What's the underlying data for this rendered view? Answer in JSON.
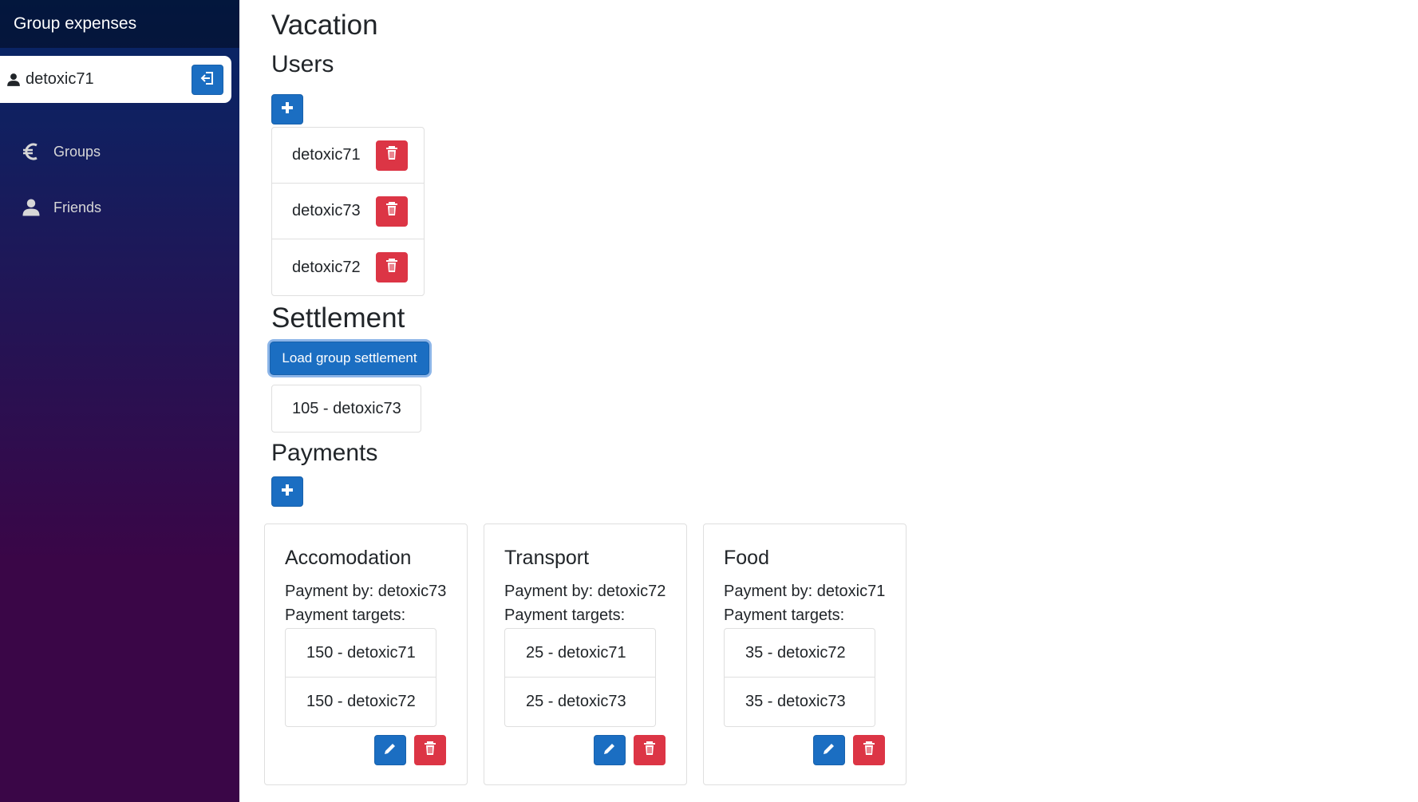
{
  "app": {
    "brand": "Group expenses"
  },
  "user": {
    "name": "detoxic71"
  },
  "nav": [
    {
      "label": "Groups",
      "icon": "euro-icon"
    },
    {
      "label": "Friends",
      "icon": "person-icon"
    }
  ],
  "group": {
    "title": "Vacation"
  },
  "users_section": {
    "heading": "Users",
    "users": [
      "detoxic71",
      "detoxic73",
      "detoxic72"
    ]
  },
  "settlement": {
    "heading": "Settlement",
    "load_button": "Load group settlement",
    "result": "105 - detoxic73"
  },
  "payments": {
    "heading": "Payments",
    "items": [
      {
        "title": "Accomodation",
        "by": "Payment by: detoxic73",
        "targets_label": "Payment targets:",
        "targets": [
          "150 - detoxic71",
          "150 - detoxic72"
        ]
      },
      {
        "title": "Transport",
        "by": "Payment by: detoxic72",
        "targets_label": "Payment targets:",
        "targets": [
          "25 - detoxic71",
          "25 - detoxic73"
        ]
      },
      {
        "title": "Food",
        "by": "Payment by: detoxic71",
        "targets_label": "Payment targets:",
        "targets": [
          "35 - detoxic72",
          "35 - detoxic73"
        ]
      }
    ]
  },
  "colors": {
    "primary": "#1b6ec2",
    "danger": "#dc3545",
    "sidebar_top": "#052767",
    "sidebar_bottom": "#3a0647"
  }
}
